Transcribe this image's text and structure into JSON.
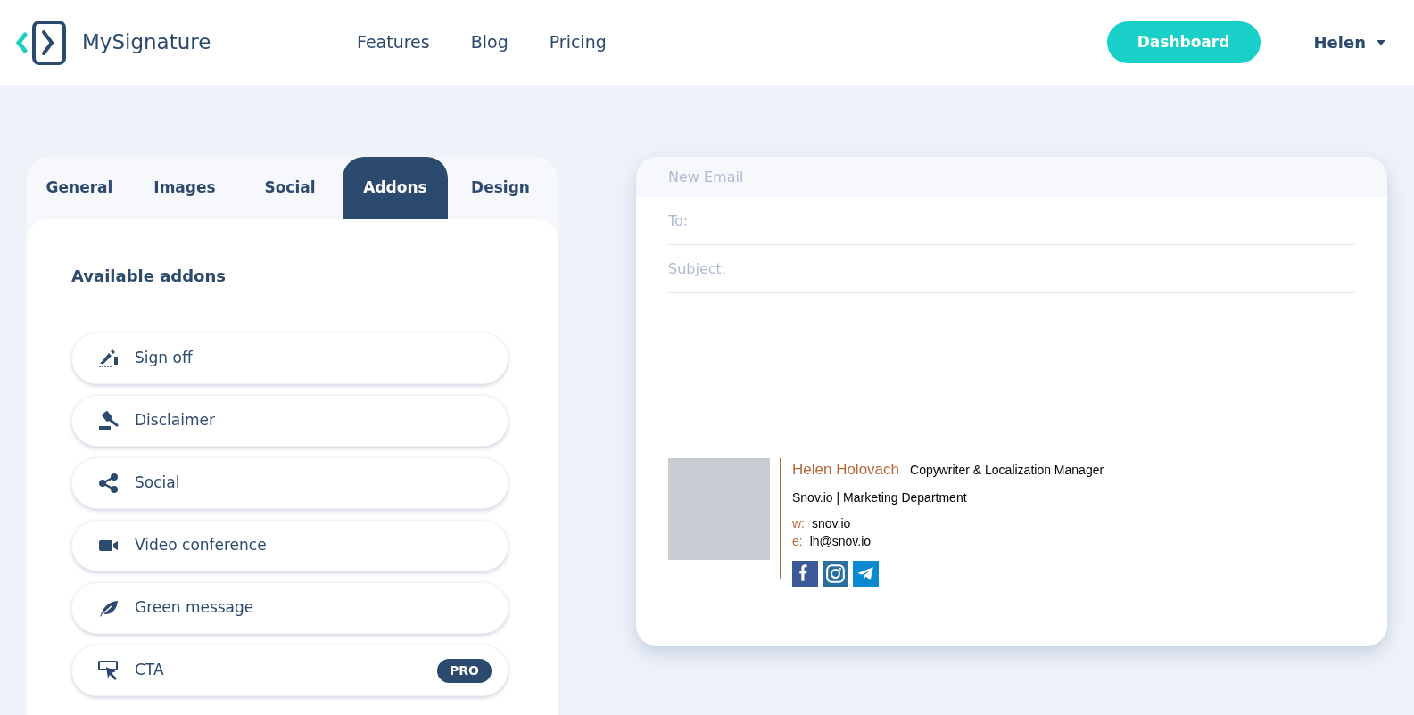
{
  "header": {
    "logo_text": "MySignature",
    "nav": [
      "Features",
      "Blog",
      "Pricing"
    ],
    "dashboard_button": "Dashboard",
    "user_menu": "Helen"
  },
  "editor": {
    "tabs": [
      {
        "label": "General",
        "selected": false
      },
      {
        "label": "Images",
        "selected": false
      },
      {
        "label": "Social",
        "selected": false
      },
      {
        "label": "Addons",
        "selected": true
      },
      {
        "label": "Design",
        "selected": false
      }
    ],
    "heading": "Available addons",
    "addons": [
      {
        "kind": "sign-off",
        "label": "Sign off"
      },
      {
        "kind": "disclaimer",
        "label": "Disclaimer"
      },
      {
        "kind": "social",
        "label": "Social"
      },
      {
        "kind": "video",
        "label": "Video conference"
      },
      {
        "kind": "green",
        "label": "Green message"
      },
      {
        "kind": "cta",
        "label": "CTA",
        "badge": "PRO"
      }
    ]
  },
  "email_preview": {
    "title": "New Email",
    "to_label": "To:",
    "subject_label": "Subject:",
    "signature": {
      "name": "Helen Holovach",
      "job_title": "Copywriter & Localization Manager",
      "company": "Snov.io | Marketing Department",
      "contacts": [
        {
          "label": "w:",
          "value": "snov.io"
        },
        {
          "label": "e:",
          "value": "lh@snov.io"
        }
      ],
      "social": [
        {
          "kind": "facebook",
          "color": "#3b5998"
        },
        {
          "kind": "instagram",
          "color": "#2a6f9e"
        },
        {
          "kind": "telegram",
          "color": "#0a88d0"
        }
      ]
    }
  }
}
